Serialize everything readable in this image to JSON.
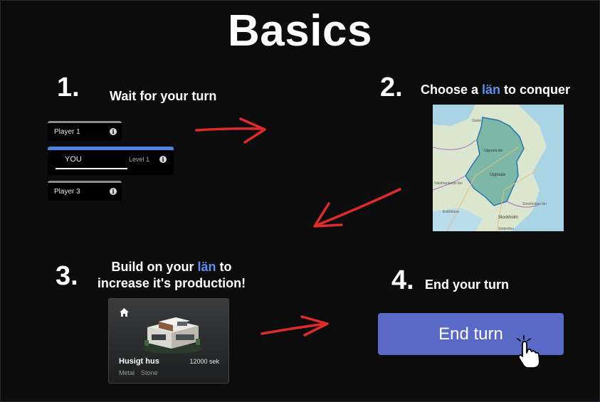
{
  "title": "Basics",
  "steps": [
    {
      "number": "1.",
      "text": "Wait for your turn"
    },
    {
      "number": "2.",
      "text_before": "Choose a ",
      "highlight": "län",
      "text_after": " to conquer"
    },
    {
      "number": "3.",
      "line1_before": "Build on your ",
      "highlight": "län",
      "line1_after": " to",
      "line2": "increase it's production!"
    },
    {
      "number": "4.",
      "text": "End your turn"
    }
  ],
  "players": [
    {
      "name": "Player 1"
    },
    {
      "name": "YOU",
      "level": "Level 1"
    },
    {
      "name": "Player 3"
    }
  ],
  "info_glyph": "i",
  "map": {
    "labels": [
      "Gävle",
      "Uppsala län",
      "Uppsala",
      "Eskilstuna",
      "Stockholm",
      "Stockholms län",
      "Södertörn",
      "Västmanlands län"
    ]
  },
  "building": {
    "name": "Husigt hus",
    "price": "12000 sek",
    "materials": [
      "Metal",
      "Stone"
    ]
  },
  "end_turn_label": "End turn",
  "icons": [
    "info-icon",
    "home-icon",
    "hand-pointer-icon",
    "arrow-icon"
  ],
  "colors": {
    "accent": "#5b8ff0",
    "button": "#5a68c6",
    "arrow": "#e02b2b",
    "region": "#2f8f86"
  }
}
